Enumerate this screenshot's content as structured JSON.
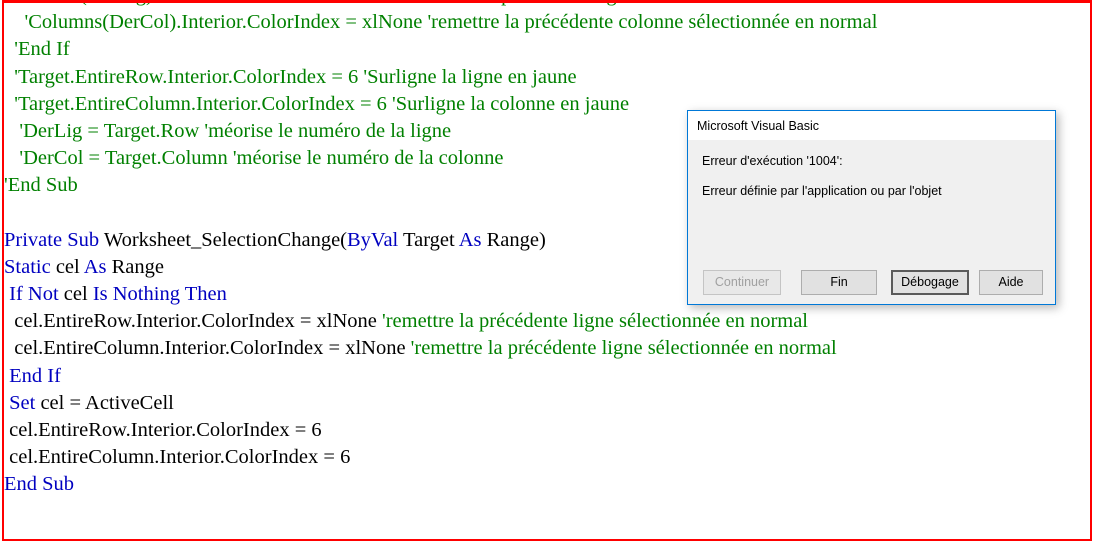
{
  "window": {
    "frame_border_color": "#ff0000",
    "background": "#ffffff"
  },
  "code": {
    "syntax_colors": {
      "keyword": "#0000C0",
      "identifier": "#000000",
      "comment": "#008000"
    },
    "lines": [
      {
        "indent": 5,
        "clipped_top": true,
        "tokens": [
          {
            "type": "cmt",
            "text": "'Rows(DerLig).Interior.ColorIndex = xlNone 'remettre la précédente ligne sélectionnée en normal"
          }
        ]
      },
      {
        "indent": 4,
        "tokens": [
          {
            "type": "cmt",
            "text": "'Columns(DerCol).Interior.ColorIndex = xlNone 'remettre la précédente colonne sélectionnée en normal"
          }
        ]
      },
      {
        "indent": 2,
        "tokens": [
          {
            "type": "cmt",
            "text": "'End If"
          }
        ]
      },
      {
        "indent": 2,
        "tokens": [
          {
            "type": "cmt",
            "text": "'Target.EntireRow.Interior.ColorIndex = 6 'Surligne la ligne en jaune"
          }
        ]
      },
      {
        "indent": 2,
        "tokens": [
          {
            "type": "cmt",
            "text": "'Target.EntireColumn.Interior.ColorIndex = 6 'Surligne la colonne en jaune"
          }
        ]
      },
      {
        "indent": 3,
        "tokens": [
          {
            "type": "cmt",
            "text": "'DerLig = Target.Row 'méorise le numéro de la ligne"
          }
        ]
      },
      {
        "indent": 3,
        "tokens": [
          {
            "type": "cmt",
            "text": "'DerCol = Target.Column 'méorise le numéro de la colonne"
          }
        ]
      },
      {
        "indent": 0,
        "tokens": [
          {
            "type": "cmt",
            "text": "'End Sub"
          }
        ]
      },
      {
        "indent": 0,
        "tokens": []
      },
      {
        "indent": 0,
        "tokens": [
          {
            "type": "kw",
            "text": "Private Sub "
          },
          {
            "type": "idn",
            "text": "Worksheet_SelectionChange("
          },
          {
            "type": "kw",
            "text": "ByVal "
          },
          {
            "type": "idn",
            "text": "Target "
          },
          {
            "type": "kw",
            "text": "As "
          },
          {
            "type": "idn",
            "text": "Range)"
          }
        ]
      },
      {
        "indent": 0,
        "tokens": [
          {
            "type": "kw",
            "text": "Static "
          },
          {
            "type": "idn",
            "text": "cel "
          },
          {
            "type": "kw",
            "text": "As "
          },
          {
            "type": "idn",
            "text": "Range"
          }
        ]
      },
      {
        "indent": 1,
        "tokens": [
          {
            "type": "kw",
            "text": "If Not "
          },
          {
            "type": "idn",
            "text": "cel "
          },
          {
            "type": "kw",
            "text": "Is Nothing Then"
          }
        ]
      },
      {
        "indent": 2,
        "tokens": [
          {
            "type": "idn",
            "text": "cel.EntireRow.Interior.ColorIndex = xlNone "
          },
          {
            "type": "cmt",
            "text": "'remettre la précédente ligne sélectionnée en normal"
          }
        ]
      },
      {
        "indent": 2,
        "tokens": [
          {
            "type": "idn",
            "text": "cel.EntireColumn.Interior.ColorIndex = xlNone "
          },
          {
            "type": "cmt",
            "text": "'remettre la précédente ligne sélectionnée en normal"
          }
        ]
      },
      {
        "indent": 1,
        "tokens": [
          {
            "type": "kw",
            "text": "End If"
          }
        ]
      },
      {
        "indent": 1,
        "tokens": [
          {
            "type": "kw",
            "text": "Set "
          },
          {
            "type": "idn",
            "text": "cel = ActiveCell"
          }
        ]
      },
      {
        "indent": 1,
        "tokens": [
          {
            "type": "idn",
            "text": "cel.EntireRow.Interior.ColorIndex = 6"
          }
        ]
      },
      {
        "indent": 1,
        "tokens": [
          {
            "type": "idn",
            "text": "cel.EntireColumn.Interior.ColorIndex = 6"
          }
        ]
      },
      {
        "indent": 0,
        "tokens": [
          {
            "type": "kw",
            "text": "End Sub"
          }
        ]
      }
    ]
  },
  "dialog": {
    "title": "Microsoft Visual Basic",
    "message_line1": "Erreur d'exécution '1004':",
    "message_line2": "Erreur définie par l'application ou par l'objet",
    "border_color": "#0078d7",
    "buttons": [
      {
        "id": "continuer",
        "label": "Continuer",
        "state": "disabled"
      },
      {
        "id": "fin",
        "label": "Fin",
        "state": "enabled"
      },
      {
        "id": "debogage",
        "label": "Débogage",
        "state": "default"
      },
      {
        "id": "aide",
        "label": "Aide",
        "state": "enabled"
      }
    ]
  }
}
